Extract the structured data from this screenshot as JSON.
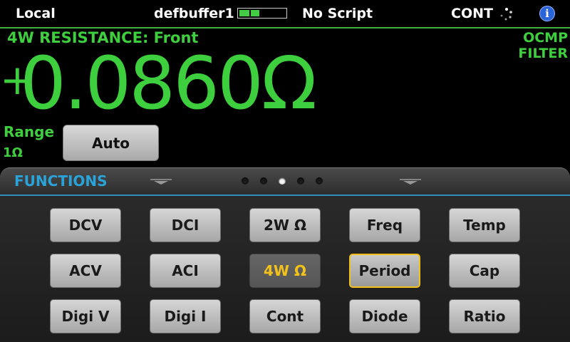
{
  "status_bar": {
    "mode": "Local",
    "buffer_name": "defbuffer1",
    "buffer_fill": 0.45,
    "script": "No Script",
    "trigger_mode": "CONT",
    "activity_icon": "activity-spinner-icon",
    "info_icon": "i"
  },
  "measurement": {
    "function_title": "4W RESISTANCE: Front",
    "sign": "+",
    "value": "0.0860Ω",
    "indicators": [
      "OCMP",
      "FILTER"
    ],
    "range_label": "Range",
    "range_value": "1Ω",
    "range_button": "Auto"
  },
  "functions_panel": {
    "title": "FUNCTIONS",
    "page_count": 5,
    "active_page": 3,
    "buttons": [
      "DCV",
      "DCI",
      "2W Ω",
      "Freq",
      "Temp",
      "ACV",
      "ACI",
      "4W Ω",
      "Period",
      "Cap",
      "Digi V",
      "Digi I",
      "Cont",
      "Diode",
      "Ratio"
    ],
    "selected": "4W Ω",
    "focused": "Period"
  },
  "colors": {
    "reading_green": "#3ecf3e",
    "panel_blue": "#2aa3d8",
    "selected_yellow": "#f2c21b"
  }
}
